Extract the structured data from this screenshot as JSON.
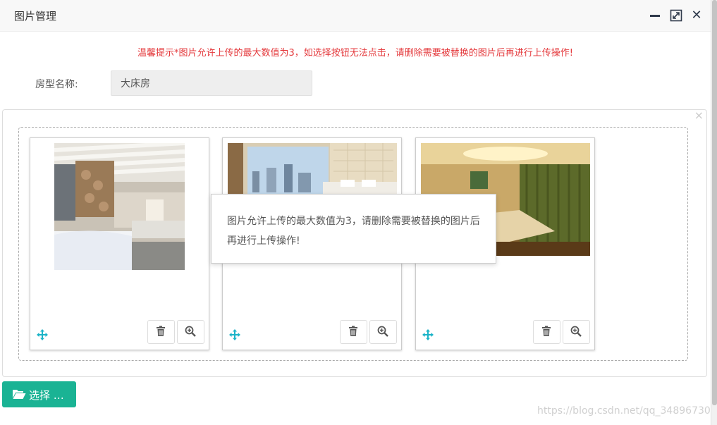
{
  "dialog": {
    "title": "图片管理",
    "minimize_icon": "minimize-icon",
    "maximize_icon": "maximize-icon",
    "close_icon": "close-icon"
  },
  "notice": "温馨提示*图片允许上传的最大数值为3，如选择按钮无法点击，请删除需要被替换的图片后再进行上传操作!",
  "room_type": {
    "label": "房型名称:",
    "value": "大床房"
  },
  "upload": {
    "images": [
      {
        "description": "wooden ceiling bedroom photo"
      },
      {
        "description": "city view hotel room photo"
      },
      {
        "description": "warm-lit hotel room photo"
      }
    ],
    "delete_icon": "trash-icon",
    "zoom_icon": "zoom-in-icon",
    "drag_icon": "move-icon",
    "tooltip": "图片允许上传的最大数值为3，请删除需要被替换的图片后再进行上传操作!",
    "select_label": "选择 …"
  },
  "colors": {
    "notice": "#e4393c",
    "primary": "#1ab394",
    "drag_icon": "#1ab3c7"
  },
  "watermark": "https://blog.csdn.net/qq_34896730"
}
